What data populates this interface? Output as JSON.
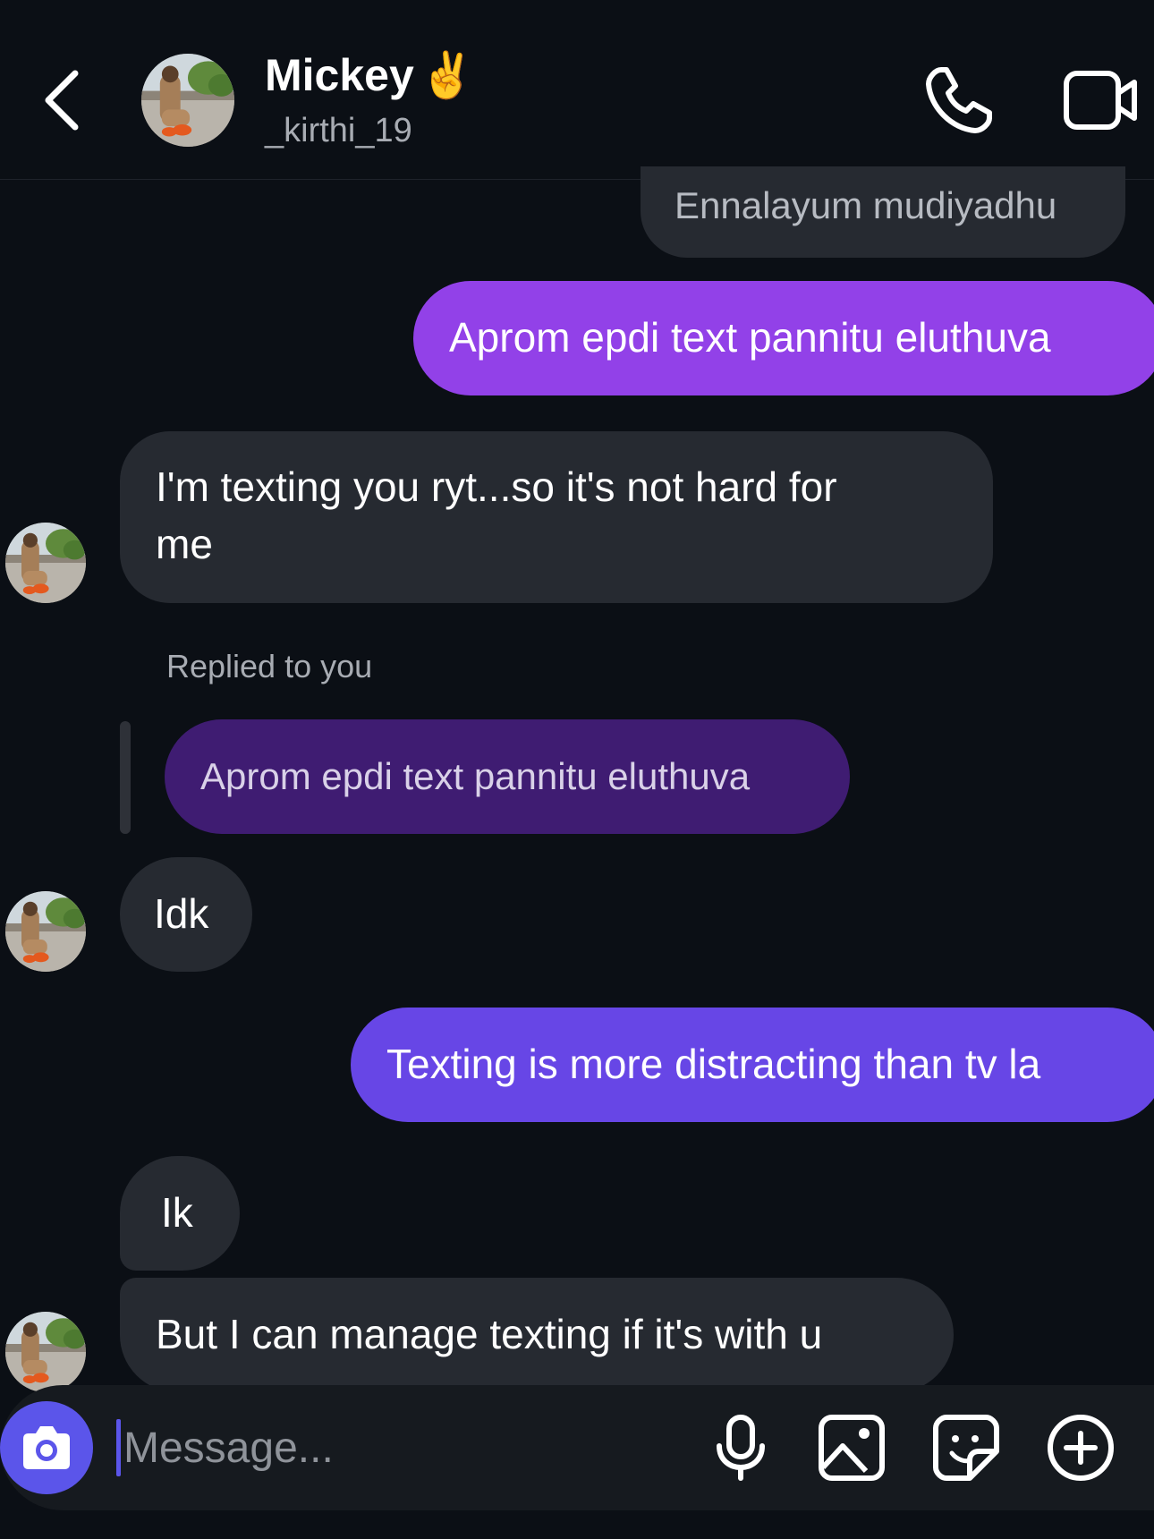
{
  "colors": {
    "background": "#0b0f15",
    "incoming_bubble": "#262a31",
    "outgoing_bubble_1": "#9241e8",
    "outgoing_bubble_2": "#6746e6",
    "reply_bubble": "#3f1c72",
    "accent": "#5b55ea"
  },
  "header": {
    "name": "Mickey",
    "emoji": "✌️",
    "handle": "_kirthi_19",
    "icons": [
      "back-chevron-icon",
      "phone-icon",
      "video-camera-icon"
    ]
  },
  "messages": [
    {
      "from": "them",
      "text": "Ennalayum mudiyadhu"
    },
    {
      "from": "me",
      "text": "Aprom epdi text pannitu eluthuva"
    },
    {
      "from": "them",
      "text_line1": "I'm texting you ryt...so it's not hard for",
      "text_line2": "me"
    },
    {
      "from": "them",
      "reply_label": "Replied to you",
      "quoted": "Aprom epdi text pannitu eluthuva"
    },
    {
      "from": "them",
      "text": "Idk"
    },
    {
      "from": "me",
      "text": "Texting is more distracting than tv la"
    },
    {
      "from": "them",
      "text": "Ik"
    },
    {
      "from": "them",
      "text": "But I can manage texting if it's with u"
    }
  ],
  "composer": {
    "placeholder": "Message...",
    "icons": [
      "camera-icon",
      "microphone-icon",
      "gallery-icon",
      "sticker-icon",
      "plus-circle-icon"
    ]
  }
}
